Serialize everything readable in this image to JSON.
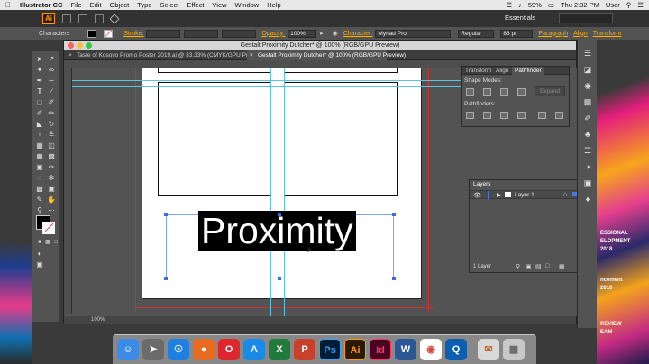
{
  "menubar": {
    "app_name": "Illustrator CC",
    "menus": [
      "File",
      "Edit",
      "Object",
      "Type",
      "Select",
      "Effect",
      "View",
      "Window",
      "Help"
    ],
    "battery": "59%",
    "clock": "Thu 2:32 PM",
    "user": "User"
  },
  "appbar": {
    "logo": "Ai",
    "workspace": "Essentials"
  },
  "controlbar": {
    "selection_label": "Characters",
    "stroke_label": "Stroke:",
    "opacity_label": "Opacity:",
    "opacity_value": "100%",
    "character_label": "Character:",
    "font_value": "Myriad Pro",
    "style_value": "Regular",
    "size_value": "83 pt",
    "paragraph_link": "Paragraph",
    "align_link": "Align",
    "transform_link": "Transform"
  },
  "document": {
    "title": "Gestalt Proximity Dutcher* @ 100% (RGB/GPU Preview)",
    "tabs": [
      {
        "label": "Taste of Kosovo Promo Poster 2019.ai @ 33.33% (CMYK/GPU Preview)"
      },
      {
        "label": "Gestalt Proximity Dutcher* @ 100% (RGB/GPU Preview)"
      }
    ],
    "artwork_text": "Proximity",
    "zoom_value": "100%"
  },
  "pathfinder_panel": {
    "tabs": [
      "Transform",
      "Align",
      "Pathfinder"
    ],
    "shape_modes_label": "Shape Modes:",
    "pathfinders_label": "Pathfinders:",
    "expand_label": "Expand"
  },
  "layers_panel": {
    "tab": "Layers",
    "layer_name": "Layer 1",
    "layer_count": "1 Layer"
  },
  "desktop_poster": {
    "lines": [
      "ESSIONAL",
      "ELOPMENT",
      "2018",
      "ncement",
      "2018",
      "REVIEW",
      "EAM"
    ]
  },
  "dock_apps": [
    "Ps",
    "Ai",
    "Id",
    "W",
    "X",
    "P"
  ],
  "colors": {
    "accent_link": "#ffb000",
    "selection_blue": "#7aa7e8",
    "guide_cyan": "#5ec3e0",
    "bleed_red": "#d03030",
    "ai_orange": "#ff9a00"
  }
}
